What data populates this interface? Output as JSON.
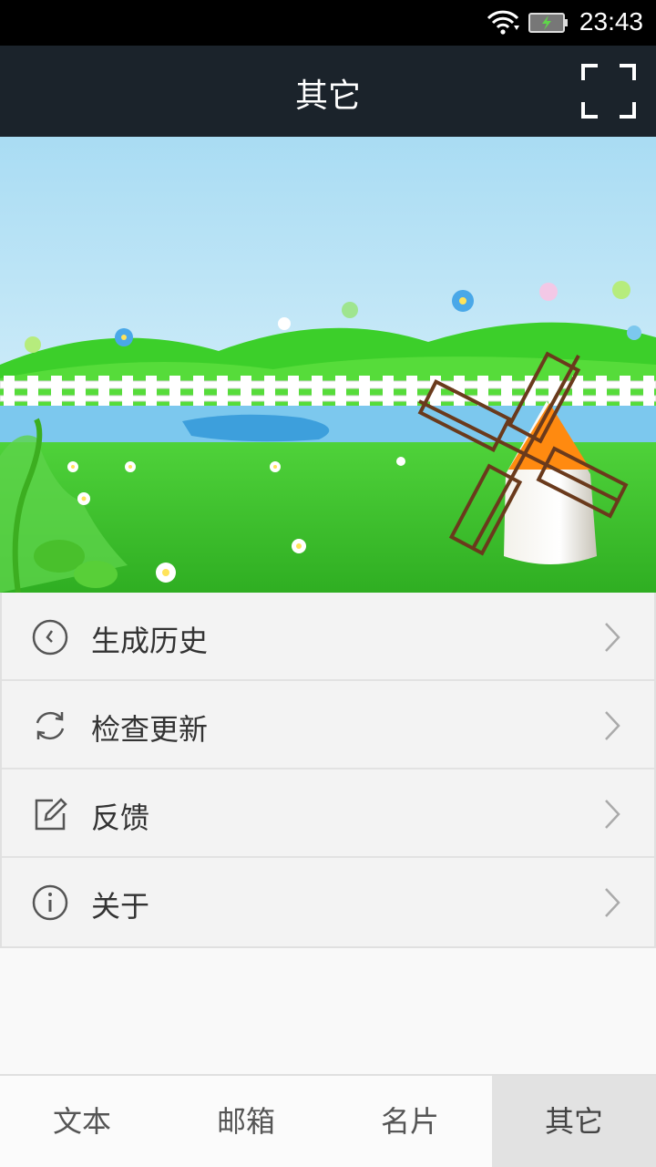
{
  "status": {
    "time": "23:43"
  },
  "header": {
    "title": "其它"
  },
  "menu": {
    "items": [
      {
        "label": "生成历史",
        "icon": "history-clock-icon"
      },
      {
        "label": "检查更新",
        "icon": "refresh-icon"
      },
      {
        "label": "反馈",
        "icon": "edit-feedback-icon"
      },
      {
        "label": "关于",
        "icon": "info-icon"
      }
    ]
  },
  "tabs": [
    {
      "label": "文本",
      "active": false
    },
    {
      "label": "邮箱",
      "active": false
    },
    {
      "label": "名片",
      "active": false
    },
    {
      "label": "其它",
      "active": true
    }
  ],
  "colors": {
    "title_bar": "#1b232b",
    "status_bar": "#000000",
    "active_tab": "#e2e2e2"
  }
}
